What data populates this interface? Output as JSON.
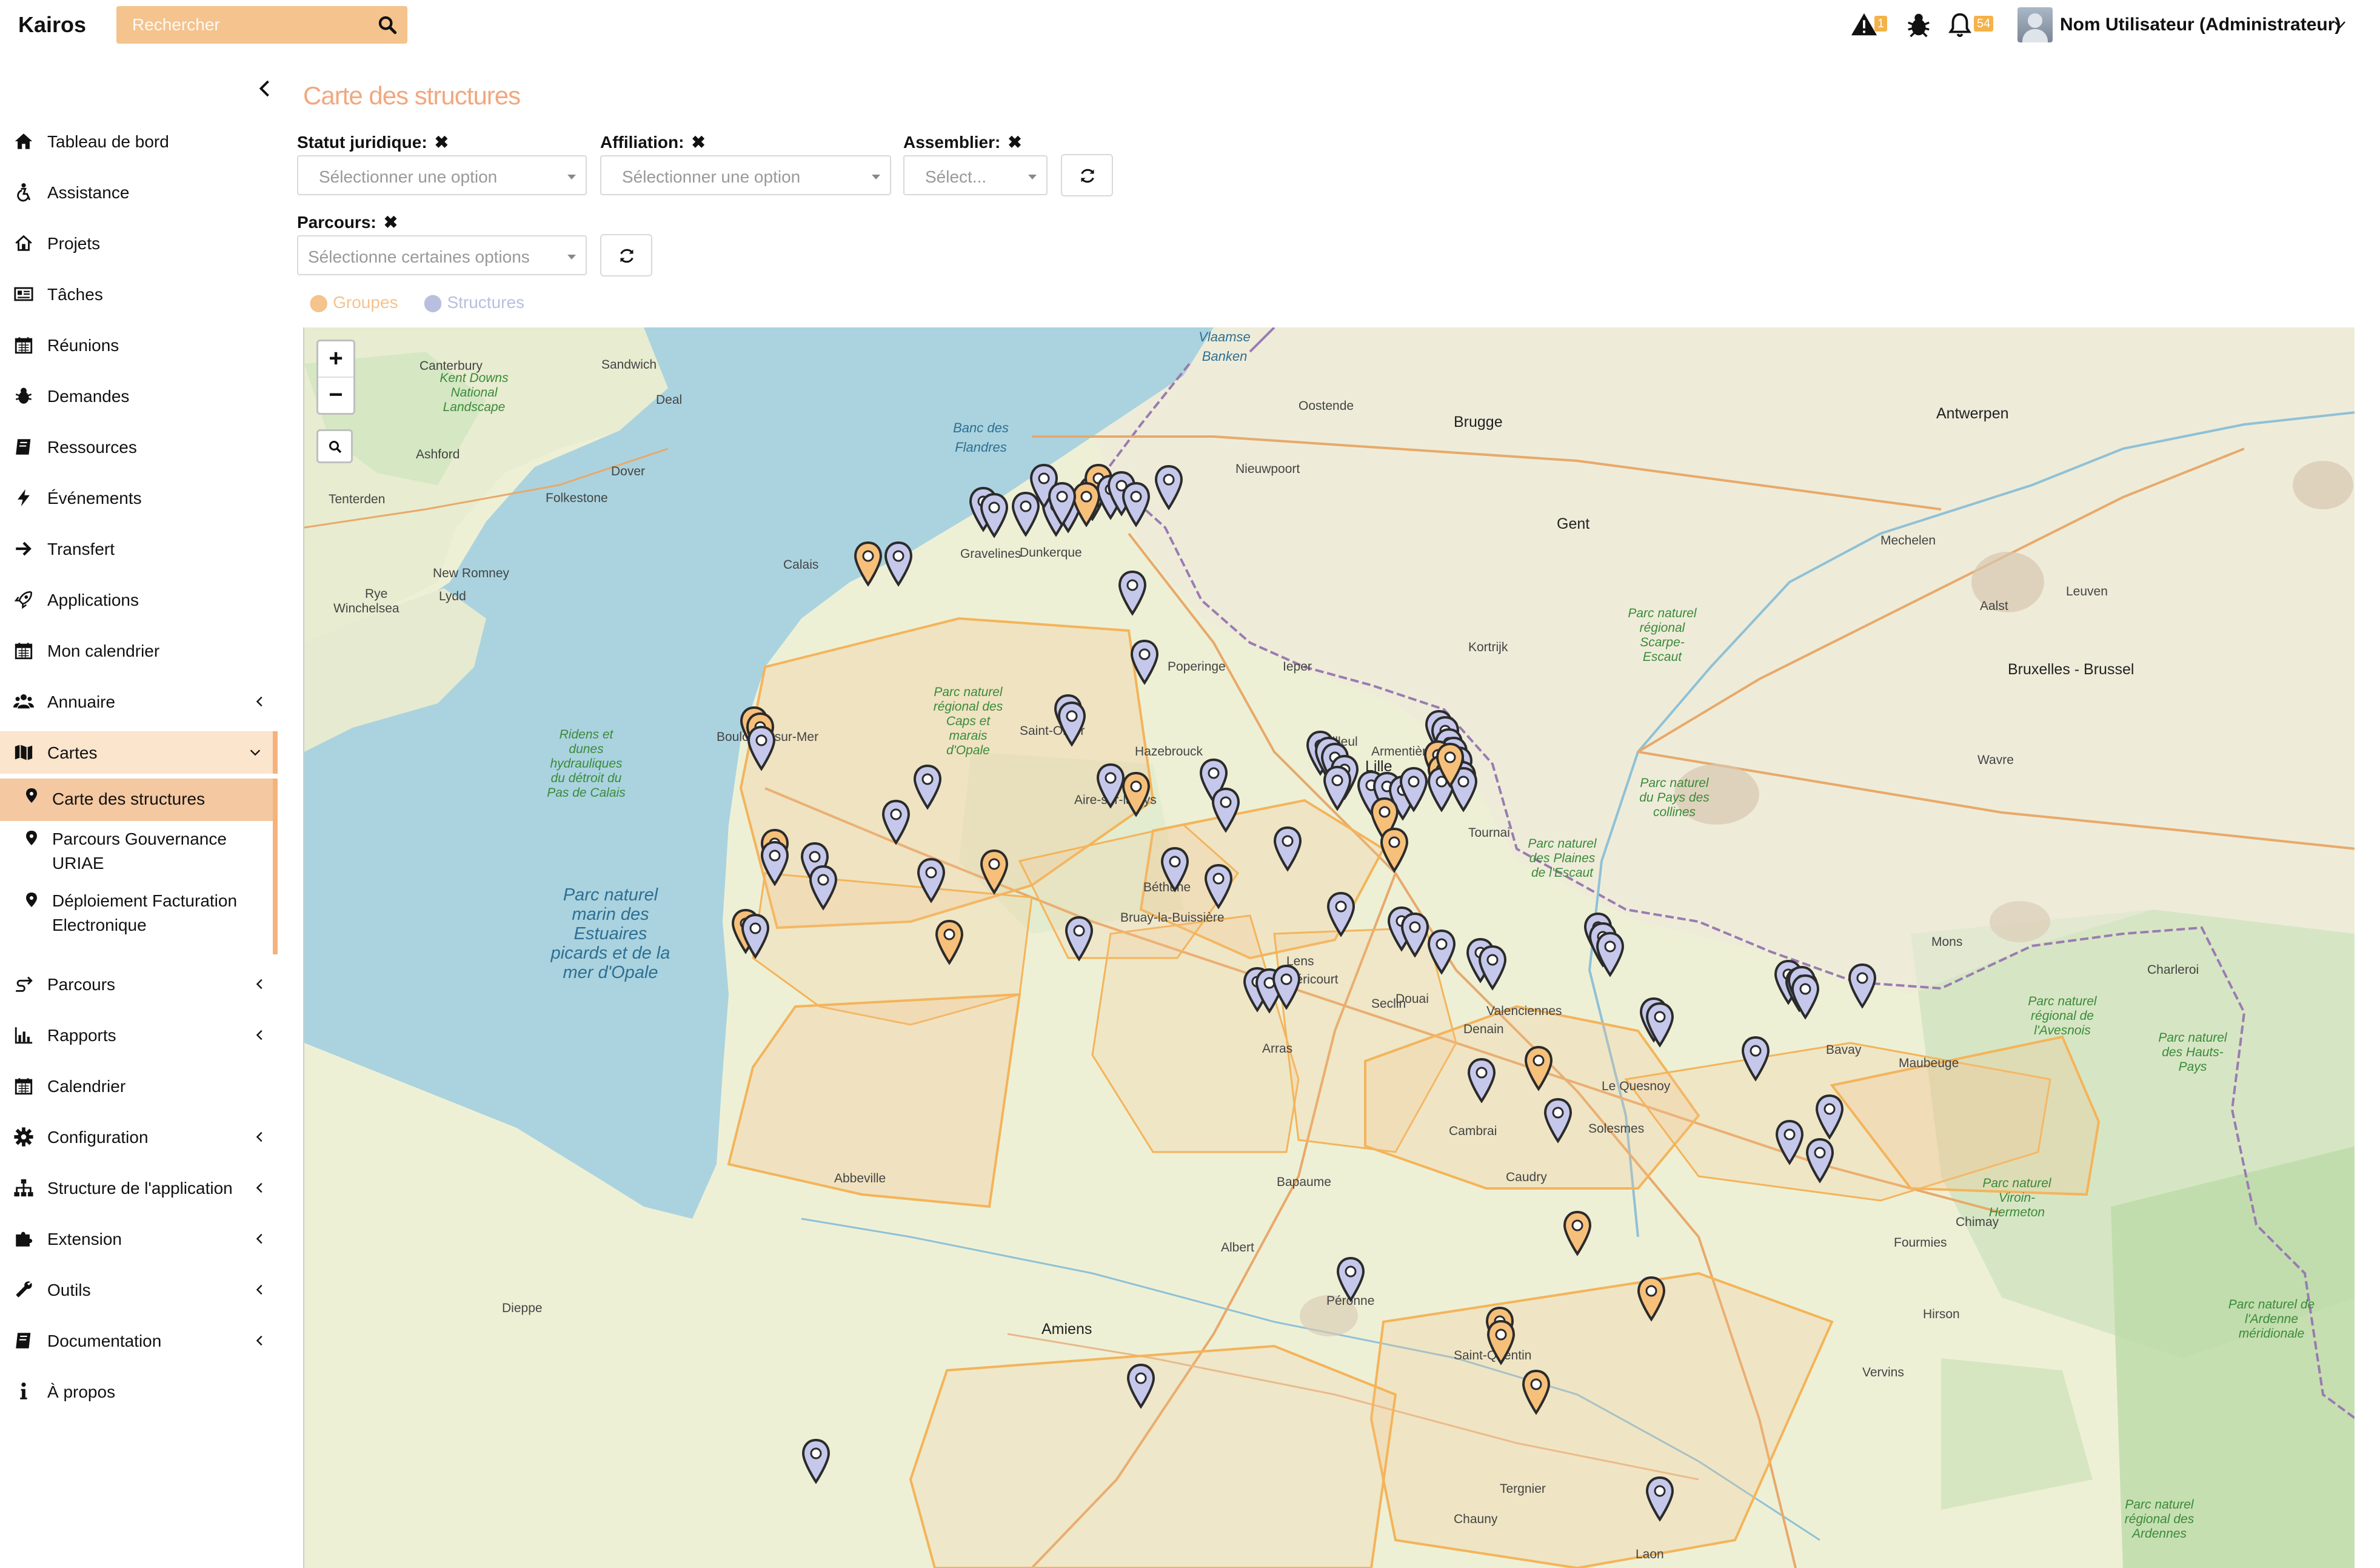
{
  "header": {
    "brand": "Kairos",
    "search_placeholder": "Rechercher",
    "alerts_count": "1",
    "notifications_count": "54",
    "user_name": "Nom Utilisateur (Administrateur)"
  },
  "sidebar": {
    "items": [
      {
        "label": "Tableau de bord",
        "icon": "home-icon"
      },
      {
        "label": "Assistance",
        "icon": "assistance-icon"
      },
      {
        "label": "Projets",
        "icon": "projects-icon"
      },
      {
        "label": "Tâches",
        "icon": "tasks-icon"
      },
      {
        "label": "Réunions",
        "icon": "calendar-icon"
      },
      {
        "label": "Demandes",
        "icon": "bug-icon"
      },
      {
        "label": "Ressources",
        "icon": "book-icon"
      },
      {
        "label": "Événements",
        "icon": "bolt-icon"
      },
      {
        "label": "Transfert",
        "icon": "arrow-right-icon"
      },
      {
        "label": "Applications",
        "icon": "rocket-icon"
      },
      {
        "label": "Mon calendrier",
        "icon": "calendar-icon"
      },
      {
        "label": "Annuaire",
        "icon": "users-icon"
      },
      {
        "label": "Cartes",
        "icon": "map-icon"
      }
    ],
    "cartes_submenu": [
      {
        "label": "Carte des structures",
        "icon": "map-marker-icon"
      },
      {
        "label": "Parcours Gouvernance URIAE",
        "icon": "map-marker-icon"
      },
      {
        "label": "Déploiement Facturation Electronique",
        "icon": "map-marker-icon"
      }
    ],
    "items_after": [
      {
        "label": "Parcours",
        "icon": "route-icon"
      },
      {
        "label": "Rapports",
        "icon": "chart-icon"
      },
      {
        "label": "Calendrier",
        "icon": "calendar-icon"
      },
      {
        "label": "Configuration",
        "icon": "gear-icon"
      },
      {
        "label": "Structure de l'application",
        "icon": "sitemap-icon"
      },
      {
        "label": "Extension",
        "icon": "puzzle-icon"
      },
      {
        "label": "Outils",
        "icon": "wrench-icon"
      },
      {
        "label": "Documentation",
        "icon": "book-icon"
      },
      {
        "label": "À propos",
        "icon": "info-icon"
      }
    ]
  },
  "main": {
    "page_title": "Carte des structures",
    "filters": {
      "statut_label": "Statut juridique:",
      "statut_placeholder": "Sélectionner une option",
      "affiliation_label": "Affiliation:",
      "affiliation_placeholder": "Sélectionner une option",
      "assembleur_label": "Assemblier:",
      "assembleur_placeholder": "Sélect...",
      "parcours_label": "Parcours:",
      "parcours_placeholder": "Sélectionne certaines options"
    },
    "legend": {
      "groupes": "Groupes",
      "structures": "Structures"
    }
  },
  "map": {
    "zoom_in": "+",
    "zoom_out": "−",
    "colors": {
      "land": "#eef0d6",
      "sea": "#aad3df",
      "group_zone": "#f4c38e",
      "group_marker": "#f6c07a",
      "structure_marker": "#c5c8ea"
    },
    "labels": [
      {
        "text": "Canterbury"
      },
      {
        "text": "Sandwich"
      },
      {
        "text": "Deal"
      },
      {
        "text": "Dover"
      },
      {
        "text": "Folkestone"
      },
      {
        "text": "Ashford"
      },
      {
        "text": "Tenterden"
      },
      {
        "text": "New Romney"
      },
      {
        "text": "Lydd"
      },
      {
        "text": "Rye"
      },
      {
        "text": "Winchelsea"
      },
      {
        "text": "Boulogne-sur-Mer"
      },
      {
        "text": "Gravelines"
      },
      {
        "text": "Saint-Omer"
      },
      {
        "text": "Hazebrouck"
      },
      {
        "text": "Aire-sur-la-Lys"
      },
      {
        "text": "Béthune"
      },
      {
        "text": "Bruay-la-Buissière"
      },
      {
        "text": "Lens"
      },
      {
        "text": "Méricourt"
      },
      {
        "text": "Douai"
      },
      {
        "text": "Arras"
      },
      {
        "text": "Seclin"
      },
      {
        "text": "Lille"
      },
      {
        "text": "Bailleul"
      },
      {
        "text": "Armentières"
      },
      {
        "text": "Tournai"
      },
      {
        "text": "Valenciennes"
      },
      {
        "text": "Denain"
      },
      {
        "text": "Cambrai"
      },
      {
        "text": "Caudry"
      },
      {
        "text": "Le Quesnoy"
      },
      {
        "text": "Maubeuge"
      },
      {
        "text": "Bavay"
      },
      {
        "text": "Solesmes"
      },
      {
        "text": "Bapaume"
      },
      {
        "text": "Albert"
      },
      {
        "text": "Péronne"
      },
      {
        "text": "Amiens"
      },
      {
        "text": "Abbeville"
      },
      {
        "text": "Dieppe"
      },
      {
        "text": "Saint-Quentin"
      },
      {
        "text": "Tergnier"
      },
      {
        "text": "Chauny"
      },
      {
        "text": "Laon"
      },
      {
        "text": "Hirson"
      },
      {
        "text": "Fourmies"
      },
      {
        "text": "Chimay"
      },
      {
        "text": "Oostende"
      },
      {
        "text": "Brugge"
      },
      {
        "text": "Gent"
      },
      {
        "text": "Kortrijk"
      },
      {
        "text": "Ieper"
      },
      {
        "text": "Antwerpen"
      },
      {
        "text": "Mechelen"
      },
      {
        "text": "Leuven"
      },
      {
        "text": "Bruxelles - Brussel"
      },
      {
        "text": "Mons"
      },
      {
        "text": "Charleroi"
      },
      {
        "text": "Aalst"
      },
      {
        "text": "Wavre"
      },
      {
        "text": "Dunkerque"
      },
      {
        "text": "Calais"
      },
      {
        "text": "Vervins"
      },
      {
        "text": "Nieuwpoort"
      },
      {
        "text": "Poperinge"
      }
    ],
    "park_labels": [
      {
        "text": "Kent Downs National Landscape"
      },
      {
        "text": "Parc naturel régional des Caps et marais d'Opale"
      },
      {
        "text": "Ridens et dunes hydrauliques du détroit du Pas de Calais"
      },
      {
        "text": "Parc naturel régional Scarpe-Escaut"
      },
      {
        "text": "Parc naturel régional de l'Avesnois"
      },
      {
        "text": "Parc naturel Viroin-Hermeton"
      },
      {
        "text": "Parc naturel régional des Ardennes"
      },
      {
        "text": "Parc naturel des Plaines de l'Escaut"
      },
      {
        "text": "Parc naturel du Pays des collines"
      },
      {
        "text": "Parc naturel de l'Ardenne méridionale"
      },
      {
        "text": "Parc naturel des Hauts-Pays"
      }
    ],
    "sea_labels": [
      {
        "text": "Parc naturel marin des Estuaires picards et de la mer d'Opale"
      },
      {
        "text": "Banc des Flandres"
      },
      {
        "text": "Vlaamse Banken"
      }
    ]
  }
}
